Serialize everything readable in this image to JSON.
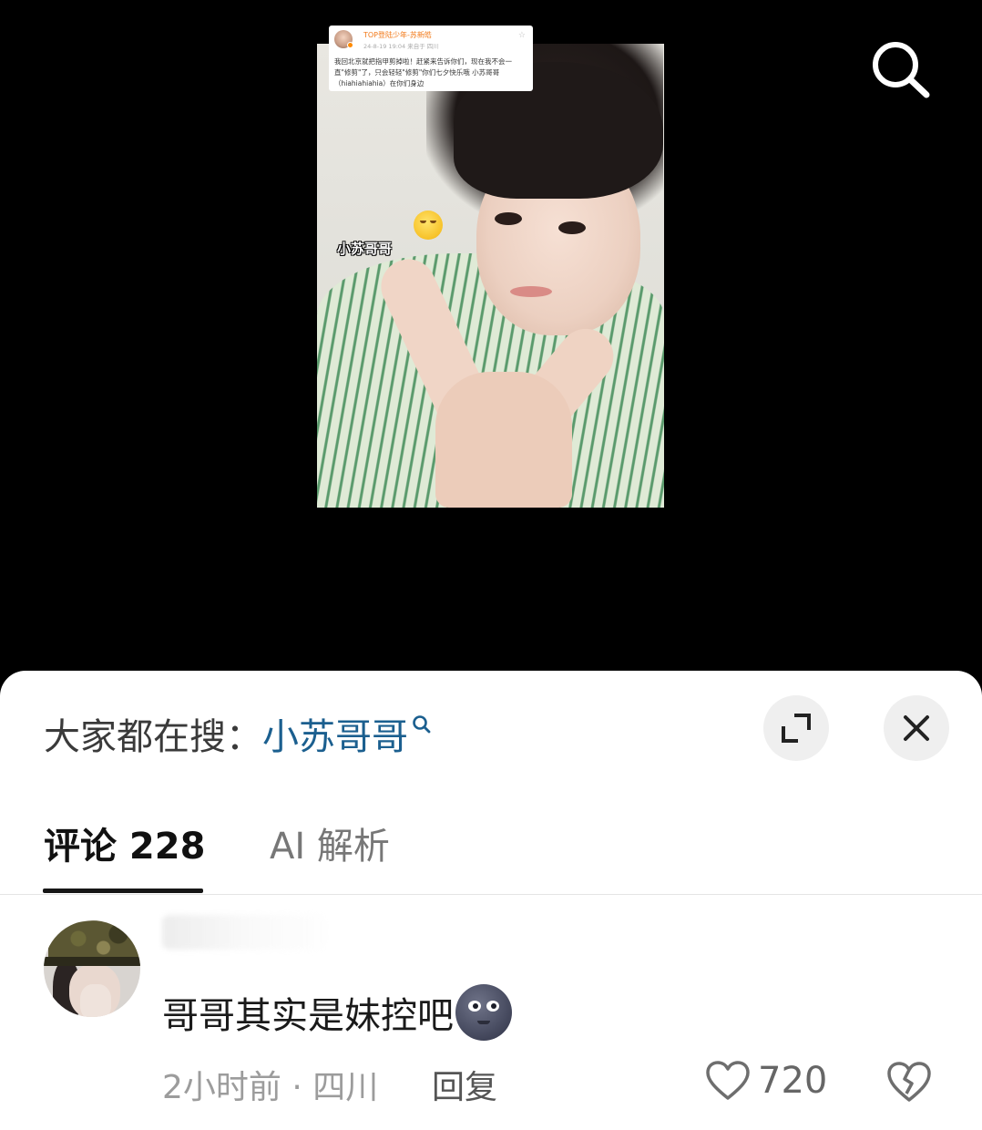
{
  "video": {
    "overlay_label": "小苏哥哥",
    "search_icon": "search-icon",
    "post_card": {
      "username": "TOP登陆少年-苏新皓",
      "meta": "24-8-19 19:04  来自于 四川",
      "text": "我回北京就把指甲剪掉啦！赶紧来告诉你们，现在我不会一直\"修剪\"了，只会轻轻\"修剪\"你们七夕快乐哦 小苏哥哥（hiahiahiahia）在你们身边"
    }
  },
  "sheet": {
    "search_hint_prefix": "大家都在搜：",
    "search_keyword": "小苏哥哥",
    "expand_icon": "expand-icon",
    "close_icon": "close-icon",
    "tabs": {
      "comments": "评论 228",
      "ai": "AI 解析"
    }
  },
  "comment": {
    "text": "哥哥其实是妹控吧",
    "emoji": "new-moon-face-emoji",
    "meta": "2小时前 · 四川",
    "reply_label": "回复",
    "like_count": "720",
    "like_icon": "heart-icon",
    "dislike_icon": "broken-heart-icon"
  },
  "colors": {
    "keyword": "#1b5f8f",
    "background": "#000000",
    "sheet": "#ffffff"
  }
}
